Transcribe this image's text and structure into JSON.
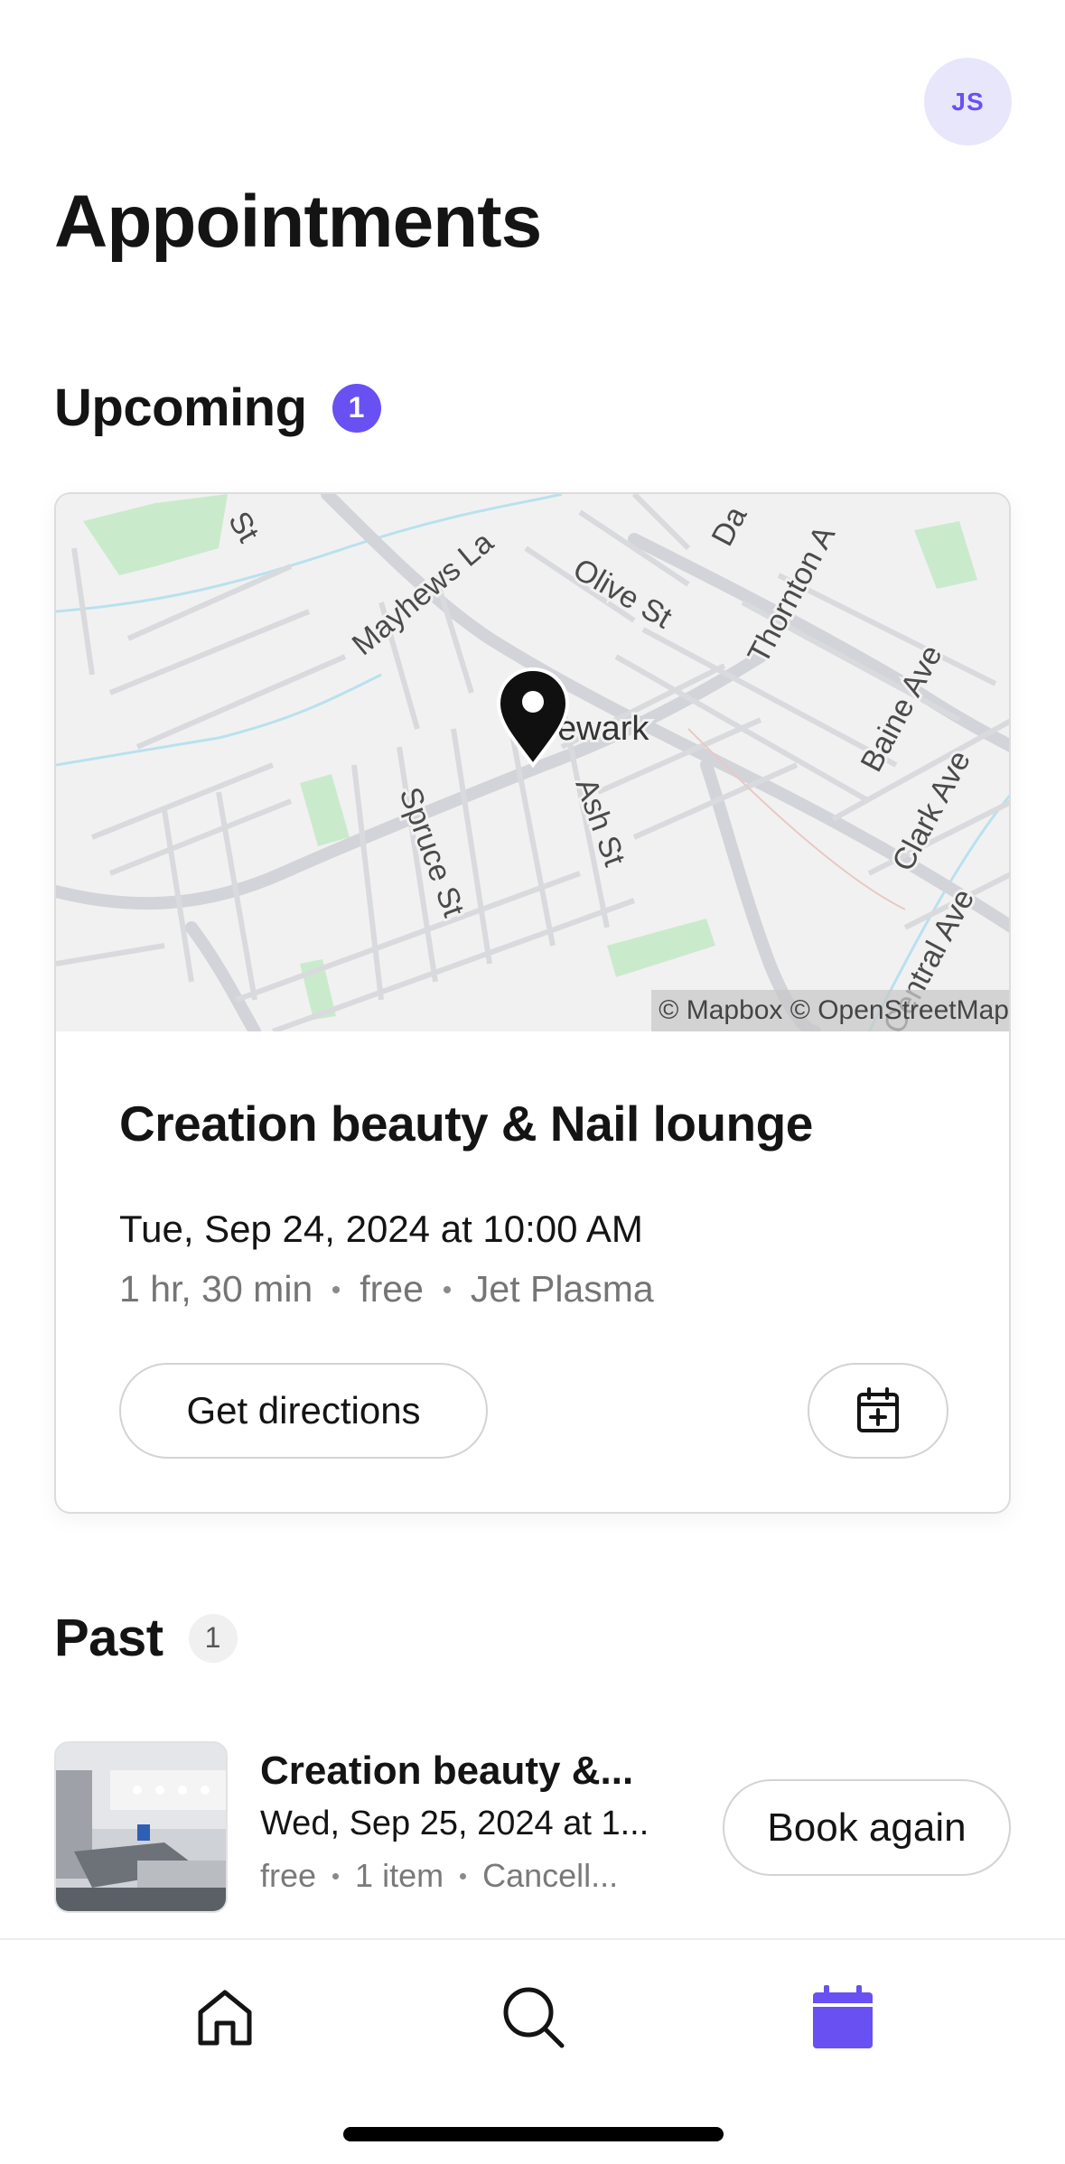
{
  "profile": {
    "initials": "JS"
  },
  "page": {
    "title": "Appointments"
  },
  "upcoming": {
    "label": "Upcoming",
    "count": "1",
    "card": {
      "map": {
        "street_labels": [
          "St",
          "Mayhews La",
          "Olive St",
          "Da",
          "Thornton A",
          "Baine Ave",
          "ewark",
          "Spruce St",
          "Ash St",
          "Clark Ave",
          "Central Ave"
        ],
        "attribution": "© Mapbox © OpenStreetMap"
      },
      "venue": "Creation beauty & Nail lounge",
      "datetime": "Tue, Sep 24, 2024 at 10:00 AM",
      "duration": "1 hr, 30 min",
      "price": "free",
      "service": "Jet Plasma",
      "directions_label": "Get directions",
      "calendar_icon": "calendar-add-icon"
    }
  },
  "past": {
    "label": "Past",
    "count": "1",
    "items": [
      {
        "venue": "Creation beauty &...",
        "datetime": "Wed, Sep 25, 2024 at 1...",
        "price": "free",
        "items": "1 item",
        "status": "Cancell...",
        "book_again_label": "Book again"
      }
    ]
  },
  "tabbar": {
    "tabs": [
      {
        "icon": "home-icon"
      },
      {
        "icon": "search-icon"
      },
      {
        "icon": "calendar-icon",
        "active": true
      }
    ]
  },
  "colors": {
    "accent": "#6950f3",
    "accent_light": "#e8e6fb"
  }
}
